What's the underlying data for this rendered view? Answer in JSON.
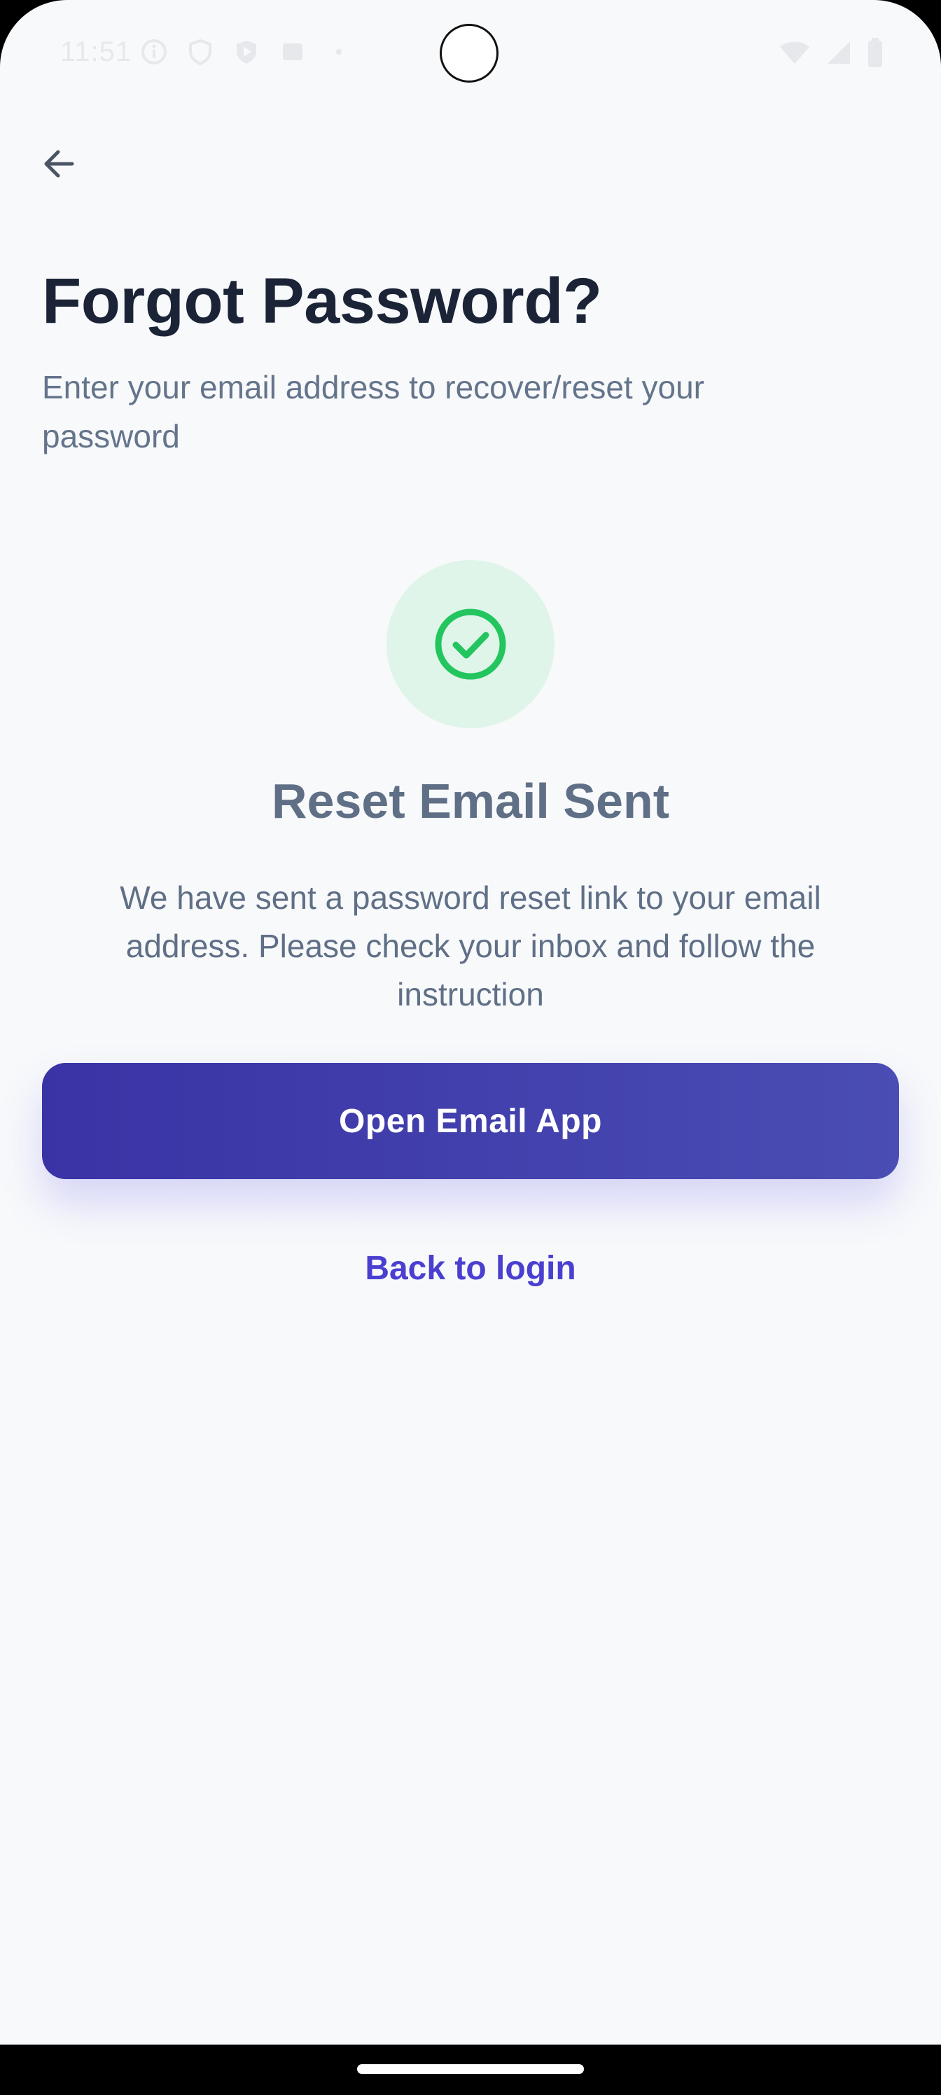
{
  "status_bar": {
    "time": "11:51",
    "icons_left": [
      "info-icon",
      "shield-icon",
      "play-protect-icon",
      "square-app-icon",
      "dot-icon"
    ],
    "icons_right": [
      "wifi-icon",
      "cell-signal-icon",
      "battery-icon"
    ]
  },
  "header": {
    "back_icon": "arrow-left-icon",
    "title": "Forgot Password?",
    "subtitle": "Enter your email address to recover/reset your password"
  },
  "success": {
    "icon": "check-circle-icon",
    "title": "Reset Email Sent",
    "message": "We have sent a password reset link to your email address. Please check your inbox and follow the instruction"
  },
  "actions": {
    "open_email_label": "Open Email App",
    "back_to_login_label": "Back to login"
  },
  "colors": {
    "background": "#F8F9FB",
    "title": "#1B2437",
    "muted_text": "#64748B",
    "primary_button_start": "#3A33A6",
    "primary_button_end": "#4A4DB3",
    "link": "#4A3FD0",
    "success_green": "#22C55E",
    "success_bg": "#DFF5E9"
  }
}
